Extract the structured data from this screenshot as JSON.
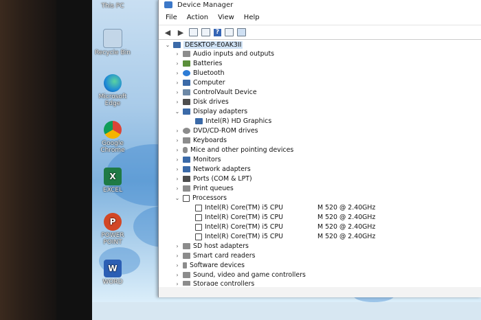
{
  "desktop_icons": [
    {
      "label": "This PC",
      "icon": "this-pc-icon",
      "color": "#4a90d9"
    },
    {
      "label": "Recycle Bin",
      "icon": "recycle-bin-icon",
      "color": "#9fb8cf"
    },
    {
      "label": "Microsoft Edge",
      "icon": "edge-icon",
      "color": "#1e8ad6"
    },
    {
      "label": "Google Chrome",
      "icon": "chrome-icon",
      "color": "#e3a11a"
    },
    {
      "label": "EXCEL",
      "icon": "excel-icon",
      "color": "#1f7a45"
    },
    {
      "label": "POWER POINT",
      "icon": "powerpoint-icon",
      "color": "#d24726"
    },
    {
      "label": "WORD",
      "icon": "word-icon",
      "color": "#2b5eb4"
    }
  ],
  "window": {
    "title": "Device Manager",
    "menu": [
      "File",
      "Action",
      "View",
      "Help"
    ],
    "root": "DESKTOP-E0AK3II",
    "categories": [
      {
        "label": "Audio inputs and outputs",
        "expanded": false,
        "icon": "speaker-icon"
      },
      {
        "label": "Batteries",
        "expanded": false,
        "icon": "battery-icon"
      },
      {
        "label": "Bluetooth",
        "expanded": false,
        "icon": "bluetooth-icon"
      },
      {
        "label": "Computer",
        "expanded": false,
        "icon": "computer-icon"
      },
      {
        "label": "ControlVault Device",
        "expanded": false,
        "icon": "controlvault-icon"
      },
      {
        "label": "Disk drives",
        "expanded": false,
        "icon": "disk-icon"
      },
      {
        "label": "Display adapters",
        "expanded": true,
        "icon": "display-icon",
        "children": [
          "Intel(R) HD Graphics"
        ]
      },
      {
        "label": "DVD/CD-ROM drives",
        "expanded": false,
        "icon": "dvd-icon"
      },
      {
        "label": "Keyboards",
        "expanded": false,
        "icon": "keyboard-icon"
      },
      {
        "label": "Mice and other pointing devices",
        "expanded": false,
        "icon": "mouse-icon"
      },
      {
        "label": "Monitors",
        "expanded": false,
        "icon": "monitor-icon"
      },
      {
        "label": "Network adapters",
        "expanded": false,
        "icon": "network-icon"
      },
      {
        "label": "Ports (COM & LPT)",
        "expanded": false,
        "icon": "port-icon"
      },
      {
        "label": "Print queues",
        "expanded": false,
        "icon": "printer-icon"
      },
      {
        "label": "Processors",
        "expanded": true,
        "icon": "processor-icon"
      },
      {
        "label": "SD host adapters",
        "expanded": false,
        "icon": "sd-icon"
      },
      {
        "label": "Smart card readers",
        "expanded": false,
        "icon": "smartcard-icon"
      },
      {
        "label": "Software devices",
        "expanded": false,
        "icon": "software-icon"
      },
      {
        "label": "Sound, video and game controllers",
        "expanded": false,
        "icon": "sound-icon"
      },
      {
        "label": "Storage controllers",
        "expanded": false,
        "icon": "storage-icon"
      }
    ],
    "processors": [
      {
        "name": "Intel(R) Core(TM) i5 CPU",
        "model": "M 520  @ 2.40GHz"
      },
      {
        "name": "Intel(R) Core(TM) i5 CPU",
        "model": "M 520  @ 2.40GHz"
      },
      {
        "name": "Intel(R) Core(TM) i5 CPU",
        "model": "M 520  @ 2.40GHz"
      },
      {
        "name": "Intel(R) Core(TM) i5 CPU",
        "model": "M 520  @ 2.40GHz"
      }
    ]
  }
}
